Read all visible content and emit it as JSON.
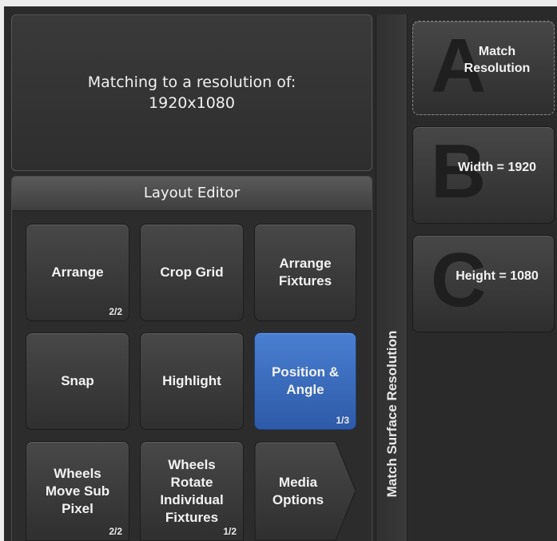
{
  "info": {
    "line1": "Matching to a resolution of:",
    "line2": "1920x1080"
  },
  "editor": {
    "title": "Layout Editor",
    "buttons": [
      {
        "label": "Arrange",
        "page": "2/2"
      },
      {
        "label": "Crop Grid",
        "page": ""
      },
      {
        "label": "Arrange Fixtures",
        "page": ""
      },
      {
        "label": "Snap",
        "page": ""
      },
      {
        "label": "Highlight",
        "page": ""
      },
      {
        "label": "Position & Angle",
        "page": "1/3"
      },
      {
        "label": "Wheels Move Sub Pixel",
        "page": "2/2"
      },
      {
        "label": "Wheels Rotate Individual Fixtures",
        "page": "1/2"
      },
      {
        "label": "Media Options",
        "page": ""
      }
    ]
  },
  "vertical_label": "Match Surface Resolution",
  "softkeys": [
    {
      "letter": "A",
      "label": "Match Resolution"
    },
    {
      "letter": "B",
      "label": "Width = 1920"
    },
    {
      "letter": "C",
      "label": "Height = 1080"
    }
  ],
  "colors": {
    "active_button": "#3a6cc0",
    "panel_bg": "#2a2a2a"
  }
}
